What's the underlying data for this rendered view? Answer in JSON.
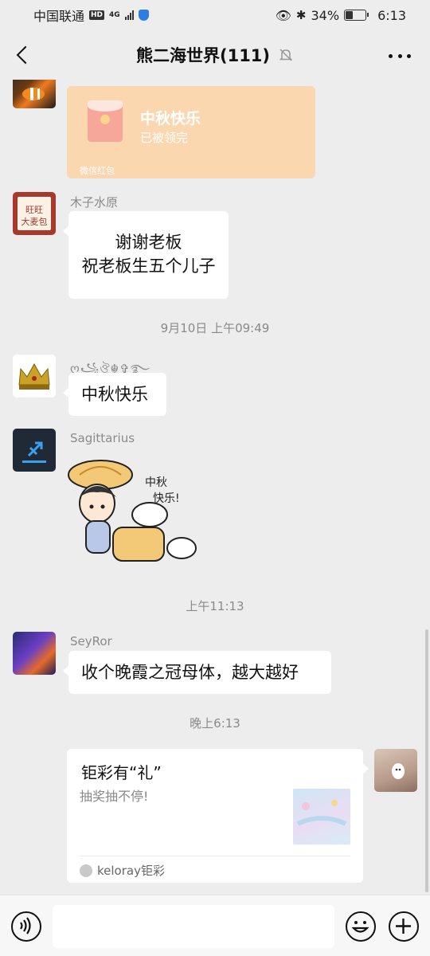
{
  "status_bar": {
    "carrier": "中国联通",
    "hd": "HD",
    "network": "4G",
    "battery": "34%",
    "time": "6:13"
  },
  "header": {
    "title": "熊二海世界(111)"
  },
  "messages": {
    "packet": {
      "title": "中秋快乐",
      "status": "已被领完",
      "footer": "微信红包"
    },
    "m1": {
      "sender": "木子水原",
      "line1": "谢谢老板",
      "line2": "祝老板生五个儿子"
    },
    "time1": "9月10日 上午09:49",
    "m2": {
      "sender": "ღ꧁ঔৣ☬✞࿐",
      "text": "中秋快乐"
    },
    "m3": {
      "sender": "Sagittarius",
      "sticker_text_1": "中秋",
      "sticker_text_2": "快乐!"
    },
    "time2": "上午11:13",
    "m4": {
      "sender": "SeyRor",
      "text": "收个晚霞之冠母体，越大越好"
    },
    "time3": "晚上6:13",
    "card": {
      "title": "钜彩有“礼”",
      "desc": "抽奖抽不停!",
      "source": "keloray钜彩"
    }
  },
  "colors": {
    "background": "#ededed",
    "packet": "#fbd7b0",
    "bubble": "#ffffff"
  }
}
